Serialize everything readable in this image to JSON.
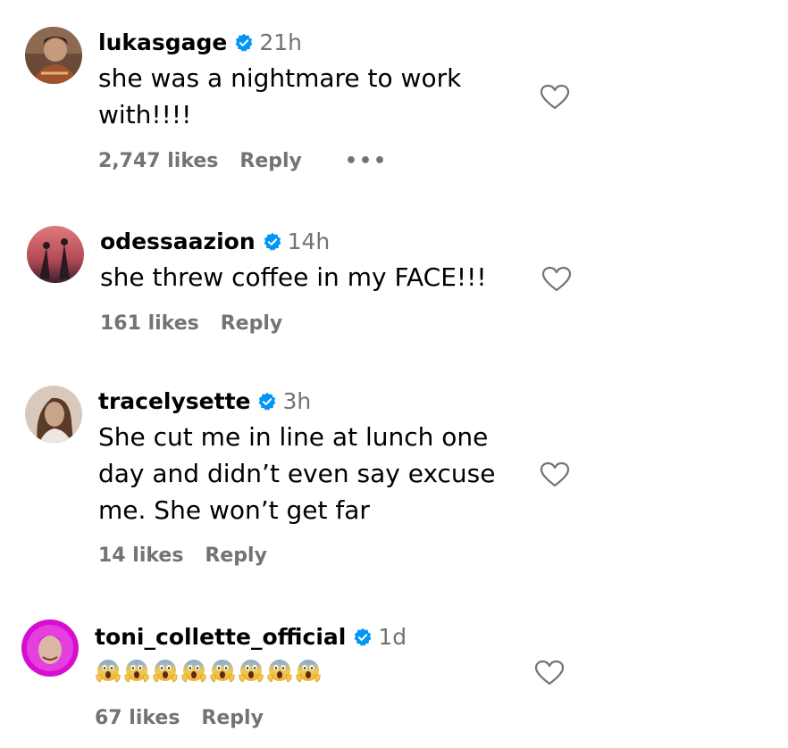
{
  "comments": [
    {
      "username": "lukasgage",
      "time": "21h",
      "text_lines": [
        "she was a nightmare to work",
        "with!!!!"
      ],
      "likes": "2,747 likes",
      "reply": "Reply",
      "more": "•••"
    },
    {
      "username": "odessaazion",
      "time": "14h",
      "text_lines": [
        "she threw coffee in my FACE!!!"
      ],
      "likes": "161 likes",
      "reply": "Reply"
    },
    {
      "username": "tracelysette",
      "time": "3h",
      "text_lines": [
        "She cut me in line at lunch one",
        "day and didn’t even say excuse",
        "me. She won’t get far"
      ],
      "likes": "14 likes",
      "reply": "Reply"
    },
    {
      "username": "toni_collette_official",
      "time": "1d",
      "text_lines": [
        "😱😱😱😱😱😱😱😱"
      ],
      "emoji_count": 8,
      "emoji_name": "face-screaming-in-fear",
      "likes": "67 likes",
      "reply": "Reply"
    }
  ],
  "colors": {
    "verified": "#0095f6",
    "secondary_text": "#737373",
    "heart_stroke": "#737373"
  },
  "icons": {
    "verified": "verified-badge-icon",
    "heart": "heart-outline-icon",
    "more": "more-dots-icon"
  }
}
